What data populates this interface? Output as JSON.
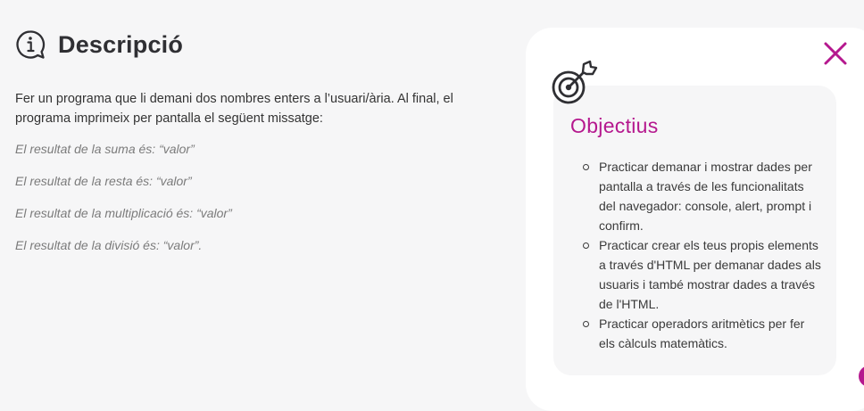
{
  "description": {
    "title": "Descripció",
    "text": "Fer un programa que li demani dos nombres enters a l’usuari/ària. Al final, el programa imprimeix per pantalla el següent missatge:",
    "messages": [
      "El resultat de la suma és: “valor”",
      "El resultat de la resta és: “valor”",
      "El resultat de la multiplicació és: “valor”",
      "El resultat de la divisió és: “valor”."
    ]
  },
  "objectives": {
    "title": "Objectius",
    "items": [
      "Practicar demanar i mostrar dades per pantalla a través de les funcionalitats del navegador: console, alert, prompt i confirm.",
      "Practicar crear els teus propis elements a través d'HTML per demanar dades als usuaris i també mostrar dades a través de l'HTML.",
      "Practicar operadors aritmètics per fer els càlculs matemàtics."
    ]
  },
  "icons": {
    "description": "info-bubble-icon",
    "objectives": "target-arrow-icon",
    "close": "close-icon"
  },
  "colors": {
    "accent": "#b5188e",
    "background": "#f6f6f7",
    "panel": "#ffffff",
    "text": "#333333",
    "muted": "#7b7b7b"
  }
}
